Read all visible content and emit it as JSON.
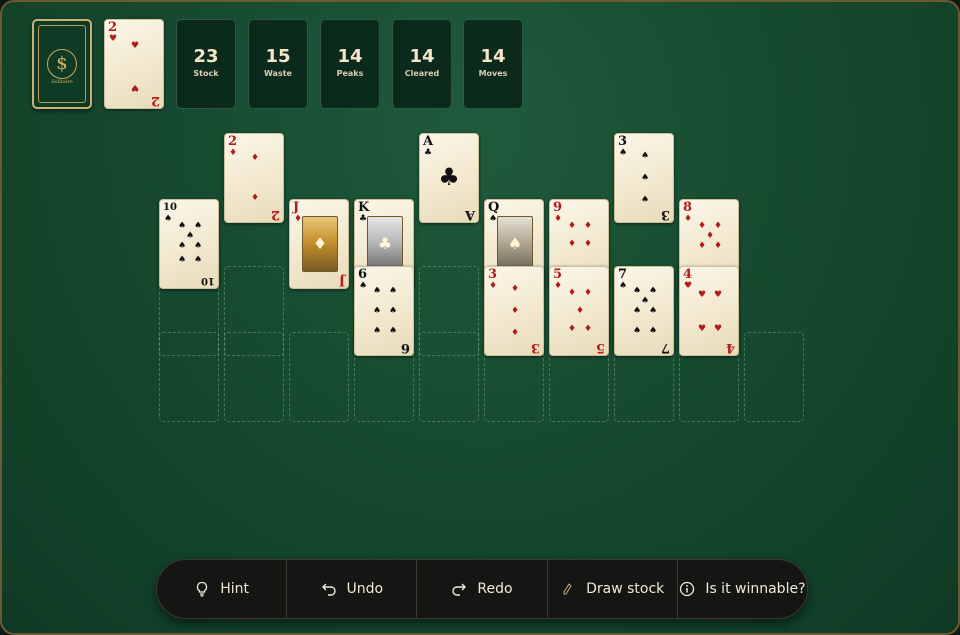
{
  "deck": {
    "icon": "solitaire-seal-icon",
    "brand": "Solitaire"
  },
  "waste_card": {
    "rank": "2",
    "suit": "♥",
    "color": "red"
  },
  "stats": [
    {
      "value": "23",
      "label": "Stock"
    },
    {
      "value": "15",
      "label": "Waste"
    },
    {
      "value": "14",
      "label": "Peaks"
    },
    {
      "value": "14",
      "label": "Cleared"
    },
    {
      "value": "14",
      "label": "Moves"
    }
  ],
  "tableau": {
    "peak_cards": [
      {
        "rank": "2",
        "suit": "♦",
        "color": "red"
      },
      {
        "rank": "A",
        "suit": "♣",
        "color": "black"
      },
      {
        "rank": "3",
        "suit": "♠",
        "color": "black"
      }
    ],
    "middle_cards": [
      {
        "rank": "10",
        "suit": "♠",
        "color": "black"
      },
      {
        "rank": "J",
        "suit": "♦",
        "color": "red"
      },
      {
        "rank": "K",
        "suit": "♣",
        "color": "black"
      },
      {
        "rank": "Q",
        "suit": "♠",
        "color": "black"
      },
      {
        "rank": "9",
        "suit": "♦",
        "color": "red"
      },
      {
        "rank": "8",
        "suit": "♦",
        "color": "red"
      }
    ],
    "lower_cards": [
      {
        "rank": "6",
        "suit": "♠",
        "color": "black"
      },
      {
        "rank": "3",
        "suit": "♦",
        "color": "red"
      },
      {
        "rank": "5",
        "suit": "♦",
        "color": "red"
      },
      {
        "rank": "7",
        "suit": "♠",
        "color": "black"
      },
      {
        "rank": "4",
        "suit": "♥",
        "color": "red"
      }
    ]
  },
  "toolbar": {
    "hint": "Hint",
    "undo": "Undo",
    "redo": "Redo",
    "draw": "Draw stock",
    "winnable": "Is it winnable?"
  },
  "colors": {
    "felt": "#154a30",
    "gold": "#c9b27a",
    "red_suit": "#b31b1b",
    "toolbar": "#151613"
  }
}
